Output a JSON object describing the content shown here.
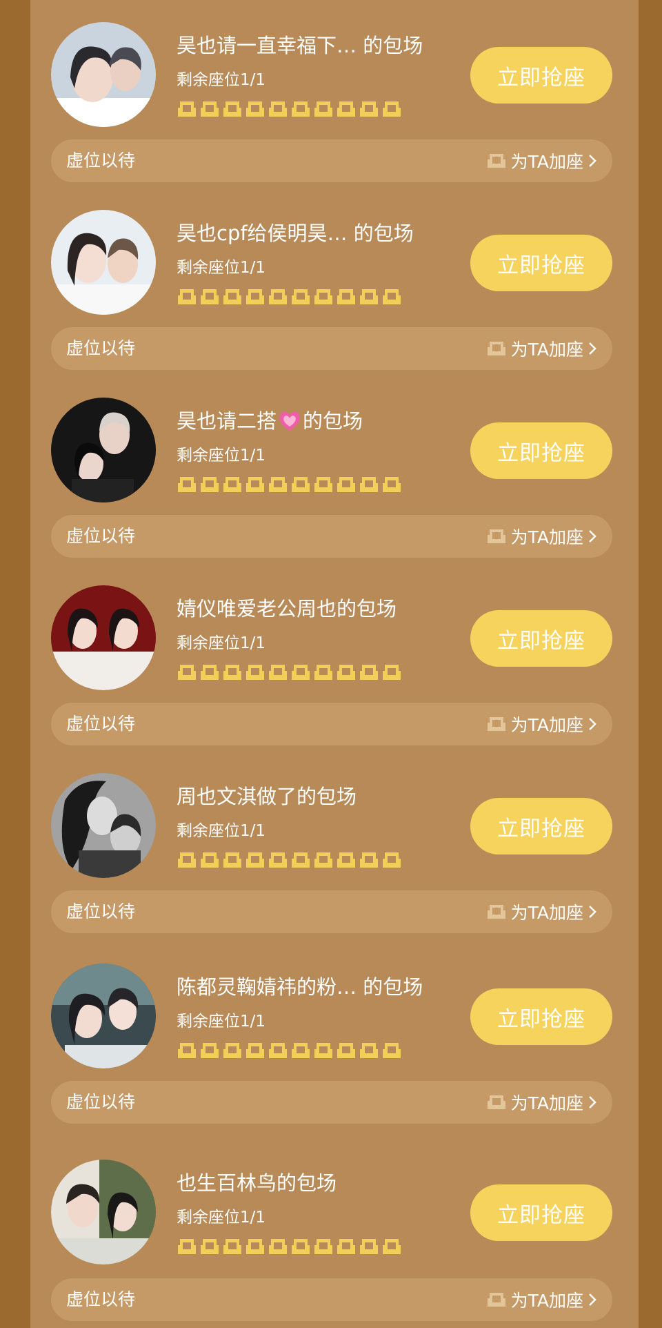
{
  "colors": {
    "background": "#9a6a2e",
    "panel": "#b88a57",
    "bar": "#c59a66",
    "button": "#f6d35c",
    "seat": "#f2cf58",
    "text": "#ffffff"
  },
  "sessions": [
    {
      "title": "昊也请一直幸福下… 的包场",
      "remaining": "剩余座位1/1",
      "button_label": "立即抢座",
      "bar_label": "虚位以待",
      "add_seat_label": "为TA加座",
      "avatar_icon": "couple-photo-avatar",
      "seat_count": 10
    },
    {
      "title": "昊也cpf给侯明昊…  的包场",
      "remaining": "剩余座位1/1",
      "button_label": "立即抢座",
      "bar_label": "虚位以待",
      "add_seat_label": "为TA加座",
      "avatar_icon": "couple-photo-avatar",
      "seat_count": 10
    },
    {
      "title": "昊也请二搭",
      "title_suffix": "的包场",
      "title_emoji": "pink-heart-icon",
      "remaining": "剩余座位1/1",
      "button_label": "立即抢座",
      "bar_label": "虚位以待",
      "add_seat_label": "为TA加座",
      "avatar_icon": "couple-photo-avatar",
      "seat_count": 10
    },
    {
      "title": "婧仪唯爱老公周也的包场",
      "remaining": "剩余座位1/1",
      "button_label": "立即抢座",
      "bar_label": "虚位以待",
      "add_seat_label": "为TA加座",
      "avatar_icon": "couple-photo-avatar",
      "seat_count": 10
    },
    {
      "title": "周也文淇做了的包场",
      "remaining": "剩余座位1/1",
      "button_label": "立即抢座",
      "bar_label": "虚位以待",
      "add_seat_label": "为TA加座",
      "avatar_icon": "couple-photo-avatar",
      "seat_count": 10
    },
    {
      "title": "陈都灵鞠婧祎的粉… 的包场",
      "remaining": "剩余座位1/1",
      "button_label": "立即抢座",
      "bar_label": "虚位以待",
      "add_seat_label": "为TA加座",
      "avatar_icon": "couple-photo-avatar",
      "seat_count": 10
    },
    {
      "title": "也生百林鸟的包场",
      "remaining": "剩余座位1/1",
      "button_label": "立即抢座",
      "bar_label": "虚位以待",
      "add_seat_label": "为TA加座",
      "avatar_icon": "couple-photo-avatar",
      "seat_count": 10
    }
  ]
}
